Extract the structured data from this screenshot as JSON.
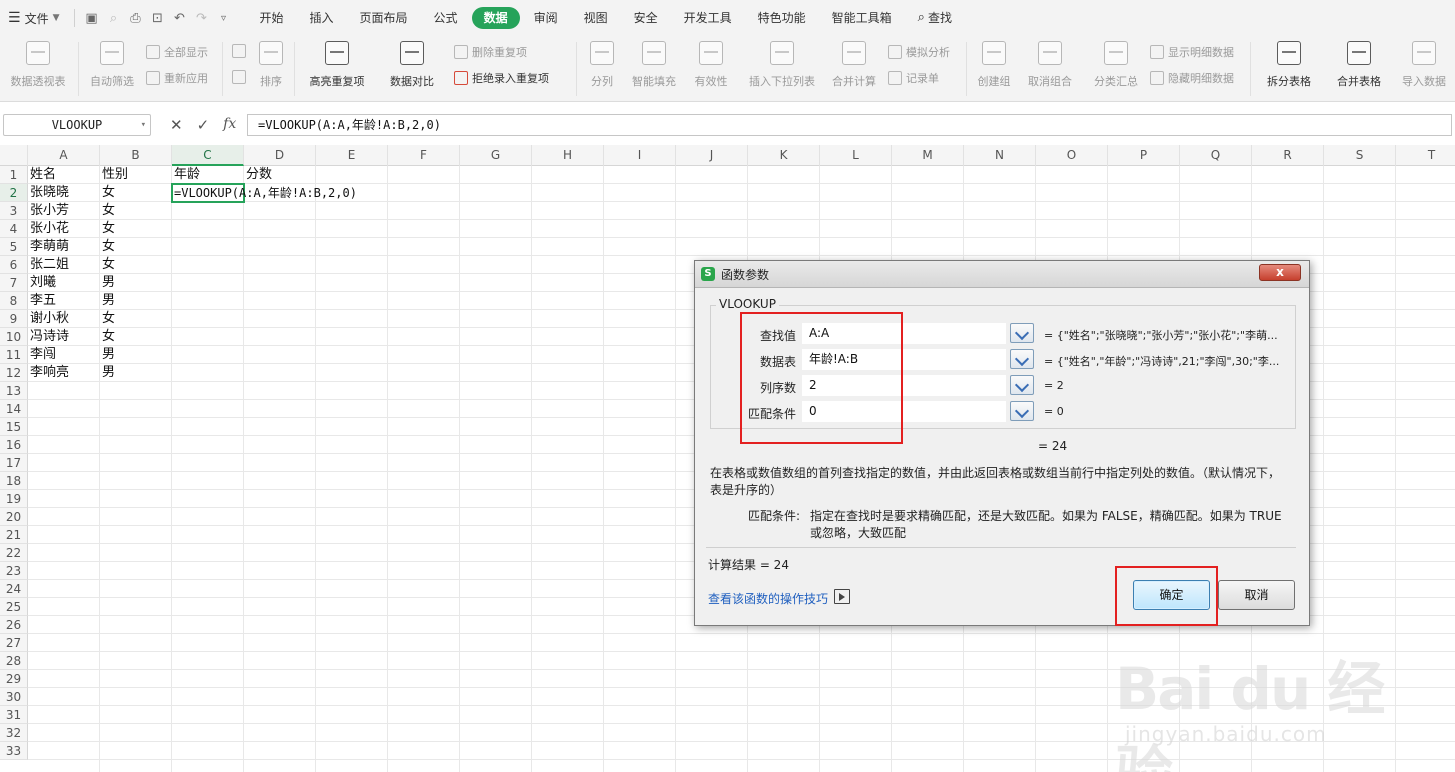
{
  "menubar": {
    "file": "文件",
    "tabs": [
      {
        "label": "开始",
        "active": false
      },
      {
        "label": "插入",
        "active": false
      },
      {
        "label": "页面布局",
        "active": false
      },
      {
        "label": "公式",
        "active": false
      },
      {
        "label": "数据",
        "active": true
      },
      {
        "label": "审阅",
        "active": false
      },
      {
        "label": "视图",
        "active": false
      },
      {
        "label": "安全",
        "active": false
      },
      {
        "label": "开发工具",
        "active": false
      },
      {
        "label": "特色功能",
        "active": false
      },
      {
        "label": "智能工具箱",
        "active": false
      }
    ],
    "search": "查找"
  },
  "ribbon": {
    "pivot": "数据透视表",
    "autofilter": "自动筛选",
    "show_all": "全部显示",
    "reapply": "重新应用",
    "sort": "排序",
    "highlight_dup": "高亮重复项",
    "compare": "数据对比",
    "delete_dup": "删除重复项",
    "reject_dup": "拒绝录入重复项",
    "split": "分列",
    "smart_fill": "智能填充",
    "validity": "有效性",
    "dropdown": "插入下拉列表",
    "consolidate": "合并计算",
    "whatif": "模拟分析",
    "record": "记录单",
    "create_group": "创建组",
    "ungroup": "取消组合",
    "subtotal": "分类汇总",
    "show_detail": "显示明细数据",
    "hide_detail": "隐藏明细数据",
    "split_table": "拆分表格",
    "merge_table": "合并表格",
    "import": "导入数据"
  },
  "formula_bar": {
    "name_box": "VLOOKUP",
    "formula": "=VLOOKUP(A:A,年龄!A:B,2,0)"
  },
  "sheet": {
    "columns": [
      "A",
      "B",
      "C",
      "D",
      "E",
      "F",
      "G",
      "H",
      "I",
      "J",
      "K",
      "L",
      "M",
      "N",
      "O",
      "P",
      "Q",
      "R",
      "S",
      "T"
    ],
    "rows": [
      "1",
      "2",
      "3",
      "4",
      "5",
      "6",
      "7",
      "8",
      "9",
      "10",
      "11",
      "12",
      "13",
      "14",
      "15",
      "16",
      "17",
      "18",
      "19",
      "20",
      "21",
      "22",
      "23",
      "24",
      "25",
      "26",
      "27",
      "28",
      "29",
      "30",
      "31",
      "32",
      "33"
    ],
    "header": {
      "a": "姓名",
      "b": "性别",
      "c": "年龄",
      "d": "分数"
    },
    "data": [
      {
        "name": "张晓晓",
        "gender": "女"
      },
      {
        "name": "张小芳",
        "gender": "女"
      },
      {
        "name": "张小花",
        "gender": "女"
      },
      {
        "name": "李萌萌",
        "gender": "女"
      },
      {
        "name": "张二姐",
        "gender": "女"
      },
      {
        "name": "刘曦",
        "gender": "男"
      },
      {
        "name": "李五",
        "gender": "男"
      },
      {
        "name": "谢小秋",
        "gender": "女"
      },
      {
        "name": "冯诗诗",
        "gender": "女"
      },
      {
        "name": "李闯",
        "gender": "男"
      },
      {
        "name": "李响亮",
        "gender": "男"
      }
    ],
    "active_cell_content": "=VLOOKUP(A:A,年龄!A:B,2,0)"
  },
  "dialog": {
    "title": "函数参数",
    "close": "x",
    "function_name": "VLOOKUP",
    "params": [
      {
        "label": "查找值",
        "value": "A:A",
        "result": "= {\"姓名\";\"张晓晓\";\"张小芳\";\"张小花\";\"李萌..."
      },
      {
        "label": "数据表",
        "value": "年龄!A:B",
        "result": "= {\"姓名\",\"年龄\";\"冯诗诗\",21;\"李闯\",30;\"李..."
      },
      {
        "label": "列序数",
        "value": "2",
        "result": "= 2"
      },
      {
        "label": "匹配条件",
        "value": "0",
        "result": "= 0"
      }
    ],
    "total": "= 24",
    "description": "在表格或数值数组的首列查找指定的数值，并由此返回表格或数组当前行中指定列处的数值。（默认情况下，表是升序的）",
    "param_desc_label": "匹配条件:",
    "param_desc": "指定在查找时是要求精确匹配，还是大致匹配。如果为 FALSE，精确匹配。如果为 TRUE 或忽略，大致匹配",
    "calc_result": "计算结果 = 24",
    "tips_link": "查看该函数的操作技巧",
    "ok": "确定",
    "cancel": "取消"
  },
  "watermark": {
    "brand": "Bai du 经验",
    "url": "jingyan.baidu.com"
  },
  "colors": {
    "accent": "#26a35a",
    "highlight": "#e32020",
    "link": "#1f5fbf"
  }
}
